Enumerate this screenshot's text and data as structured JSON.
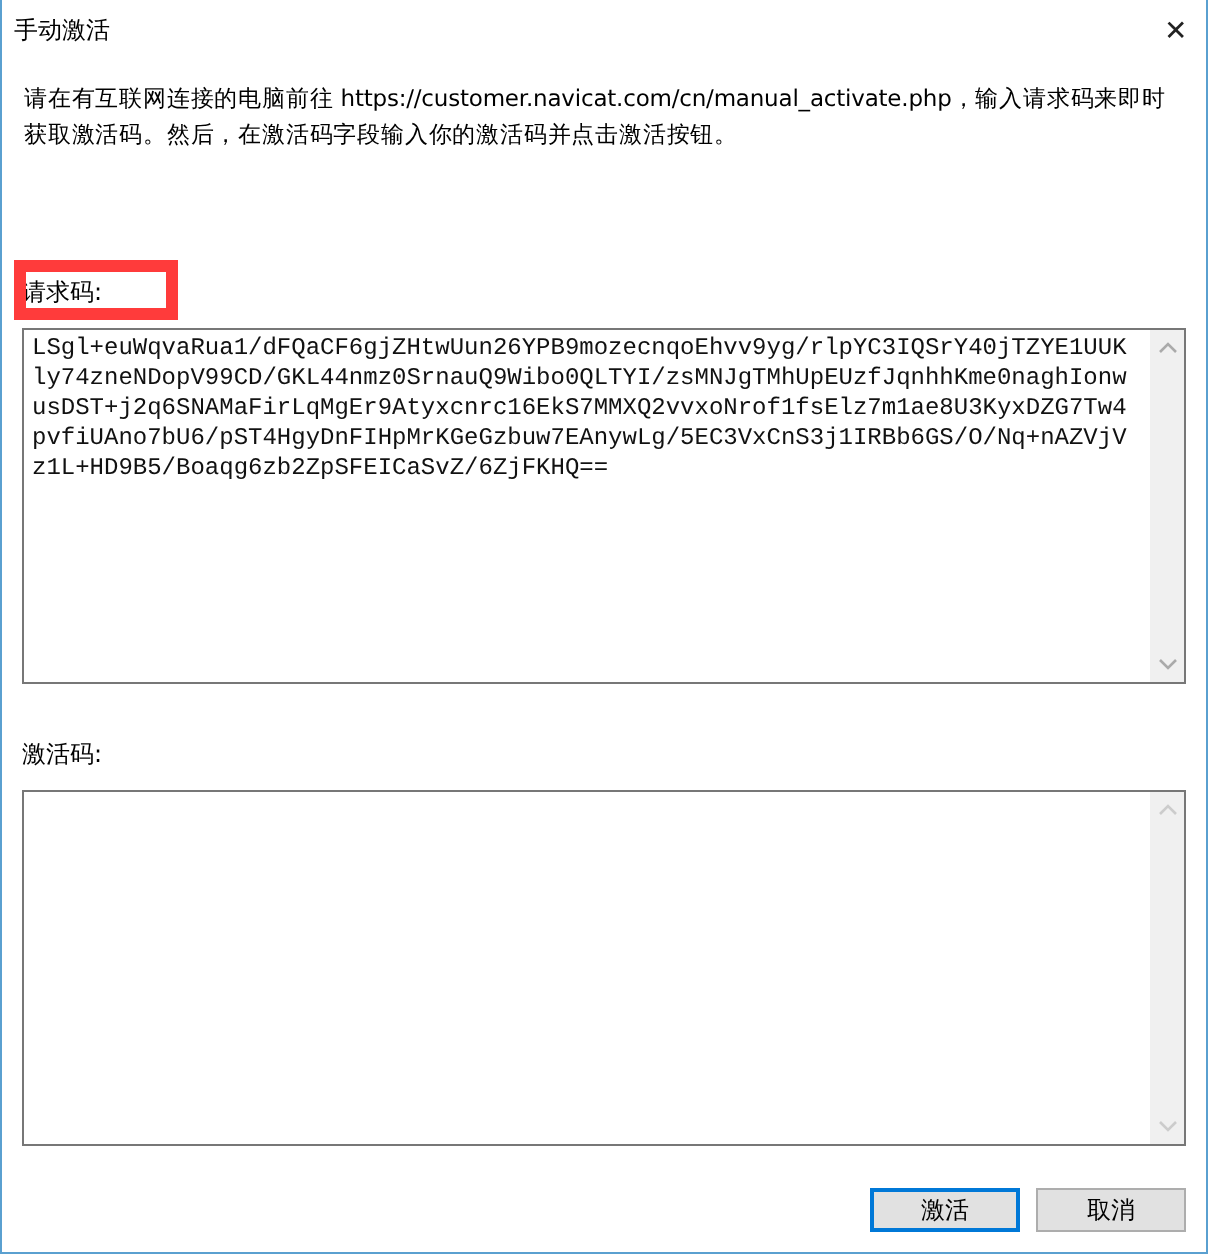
{
  "window": {
    "title": "手动激活",
    "close": "✕"
  },
  "instructions": "请在有互联网连接的电脑前往 https://customer.navicat.com/cn/manual_activate.php，输入请求码来即时获取激活码。然后，在激活码字段输入你的激活码并点击激活按钮。",
  "request_code": {
    "label": "请求码:",
    "highlighted": true,
    "lines": [
      "LSgl+euWqvaRua1/dFQaCF6gjZHtwUun26YPB9mozecnqoEhvv9yg/rlpYC3IQSrY40jTZYE1UUK",
      "ly74zneNDopV99CD/GKL44nmz0SrnauQ9Wibo0QLTYI/zsMNJgTMhUpEUzfJqnhhKme0naghIonw",
      "usDST+j2q6SNAMaFirLqMgEr9Atyxcnrc16EkS7MMXQ2vvxoNrof1fsElz7m1ae8U3KyxDZG7Tw4",
      "pvfiUAno7bU6/pST4HgyDnFIHpMrKGeGzbuw7EAnywLg/5EC3VxCnS3j1IRBb6GS/O/Nq+nAZVjV",
      "z1L+HD9B5/Boaqg6zb2ZpSFEICaSvZ/6ZjFKHQ=="
    ]
  },
  "activation_code": {
    "label": "激活码:"
  },
  "buttons": [
    {
      "label": "激活",
      "default": true
    },
    {
      "label": "取消",
      "default": false
    }
  ]
}
